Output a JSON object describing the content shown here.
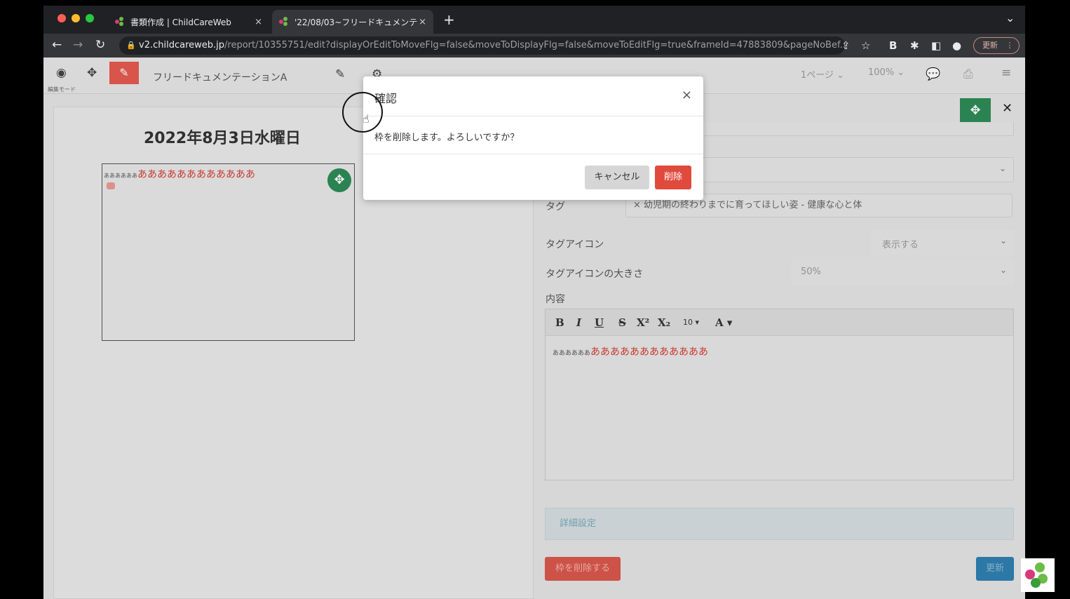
{
  "browser": {
    "tabs": [
      {
        "label": "書類作成 | ChildCareWeb",
        "close": "×"
      },
      {
        "label": "'22/08/03~フリードキュメンテ",
        "close": "×"
      }
    ],
    "new_tab": "+",
    "tab_menu": "⌄",
    "url_host": "v2.childcareweb.jp",
    "url_path": "/report/10355751/edit?displayOrEditToMoveFlg=false&moveToDisplayFlg=false&moveToEditFlg=true&frameId=47883809&pageNoBef...",
    "update_label": "更新"
  },
  "app_toolbar": {
    "doc_title": "フリードキュメンテーションA",
    "mode_label": "編集モード",
    "page_select": "1ページ",
    "zoom_select": "100%"
  },
  "left_panel": {
    "date_heading": "2022年8月3日水曜日",
    "frame_text_small": "ああああああ",
    "frame_text_red": "ああああああああああああ"
  },
  "right_panel": {
    "tag_label": "タグ",
    "tag_value": "× 幼児期の終わりまでに育ってほしい姿 - 健康な心と体",
    "tag_icon_label": "タグアイコン",
    "tag_icon_value": "表示する",
    "tag_icon_size_label": "タグアイコンの大きさ",
    "tag_icon_size_value": "50%",
    "content_label": "内容",
    "editor_toolbar": [
      "B",
      "I",
      "U",
      "S",
      "X²",
      "X₂",
      "10 ▾",
      "A ▾"
    ],
    "editor_small": "ああああああ",
    "editor_red": "ああああああああああああ",
    "detail_settings": "詳細設定",
    "delete_frame_button": "枠を削除する",
    "update_button": "更新"
  },
  "modal": {
    "title": "確認",
    "close": "×",
    "message": "枠を削除します。よろしいですか？",
    "cancel": "キャンセル",
    "delete": "削除"
  }
}
